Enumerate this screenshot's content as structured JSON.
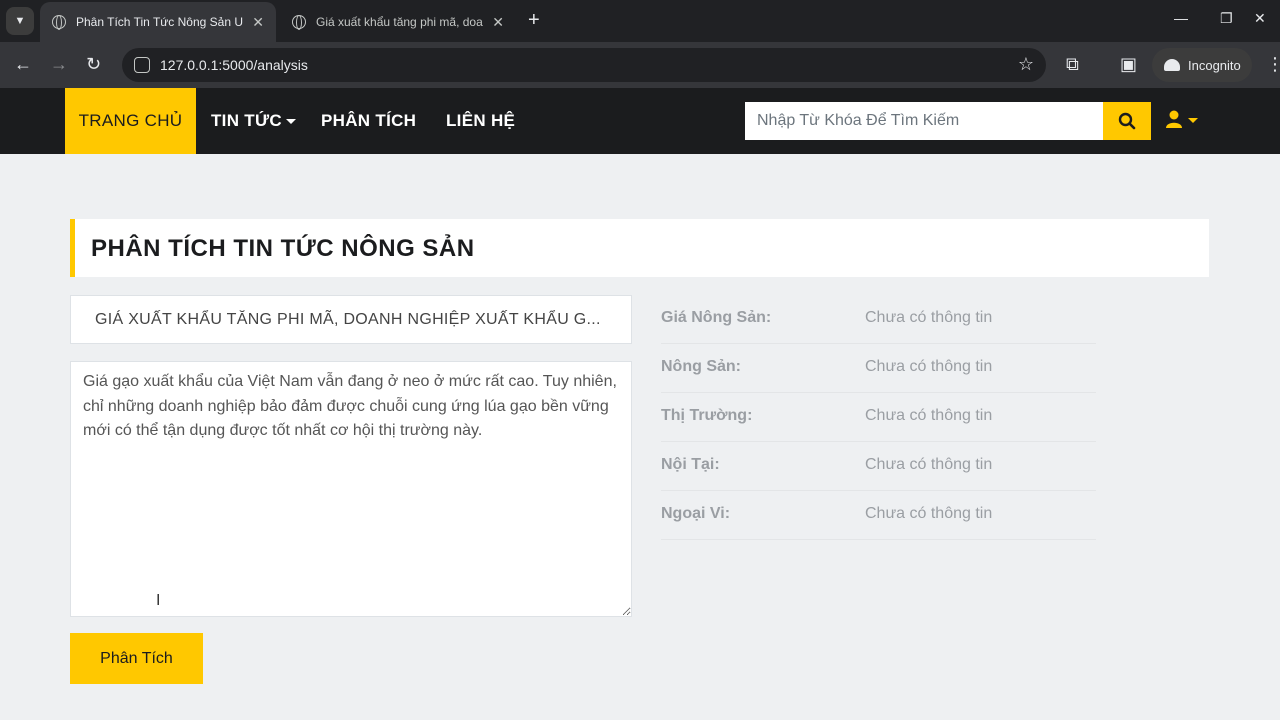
{
  "browser": {
    "tabs": [
      {
        "title": "Phân Tích Tin Tức Nông Sản U",
        "active": true
      },
      {
        "title": "Giá xuất khẩu tăng phi mã, doa",
        "active": false
      }
    ],
    "url": "127.0.0.1:5000/analysis",
    "incognito_label": "Incognito"
  },
  "nav": {
    "items": [
      {
        "label": "TRANG CHỦ"
      },
      {
        "label": "TIN TỨC"
      },
      {
        "label": "PHÂN TÍCH"
      },
      {
        "label": "LIÊN HỆ"
      }
    ],
    "search_placeholder": "Nhập Từ Khóa Để Tìm Kiếm"
  },
  "main": {
    "title": "PHÂN TÍCH TIN TỨC NÔNG SẢN",
    "news_title_value": "GIÁ XUẤT KHẨU TĂNG PHI MÃ, DOANH NGHIỆP XUẤT KHẨU G...",
    "news_content": "Giá gạo xuất khẩu của Việt Nam vẫn đang ở neo ở mức rất cao. Tuy nhiên, chỉ những doanh nghiệp bảo đảm được chuỗi cung ứng lúa gạo bền vững mới có thể tận dụng được tốt nhất cơ hội thị trường này.",
    "analyze_label": "Phân Tích",
    "info": [
      {
        "label": "Giá Nông Sản:",
        "value": "Chưa có thông tin"
      },
      {
        "label": "Nông Sản:",
        "value": "Chưa có thông tin"
      },
      {
        "label": "Thị Trường:",
        "value": "Chưa có thông tin"
      },
      {
        "label": "Nội Tại:",
        "value": "Chưa có thông tin"
      },
      {
        "label": "Ngoại Vi:",
        "value": "Chưa có thông tin"
      }
    ]
  },
  "colors": {
    "accent": "#ffc800",
    "nav_bg": "#1b1c1e",
    "page_bg": "#eef0f2"
  }
}
